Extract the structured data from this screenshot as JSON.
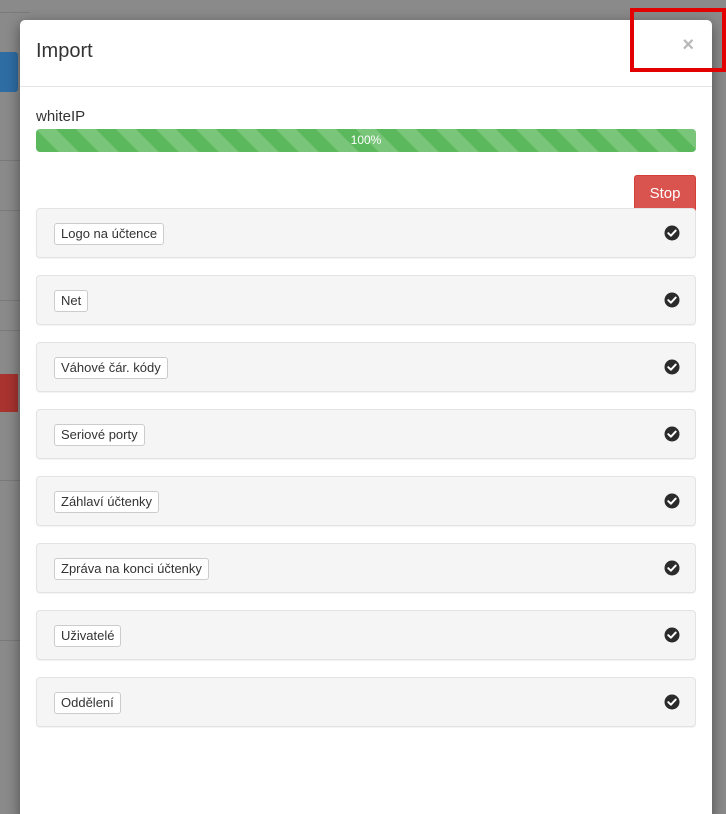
{
  "modal": {
    "title": "Import",
    "close_label": "×"
  },
  "progress": {
    "label": "whiteIP",
    "value_text": "100%",
    "fraction": 1.0
  },
  "stop_label": "Stop",
  "items": [
    {
      "label": "Logo na účtence",
      "icon": "check-circle-icon"
    },
    {
      "label": "Net",
      "icon": "check-circle-icon"
    },
    {
      "label": "Váhové čár. kódy",
      "icon": "check-circle-icon"
    },
    {
      "label": "Seriové porty",
      "icon": "check-circle-icon"
    },
    {
      "label": "Záhlaví účtenky",
      "icon": "check-circle-icon"
    },
    {
      "label": "Zpráva na konci účtenky",
      "icon": "check-circle-icon"
    },
    {
      "label": "Uživatelé",
      "icon": "check-circle-icon"
    },
    {
      "label": "Oddělení",
      "icon": "check-circle-icon"
    }
  ],
  "colors": {
    "success": "#5cb85c",
    "danger": "#d9534f",
    "highlight": "#e30000"
  }
}
